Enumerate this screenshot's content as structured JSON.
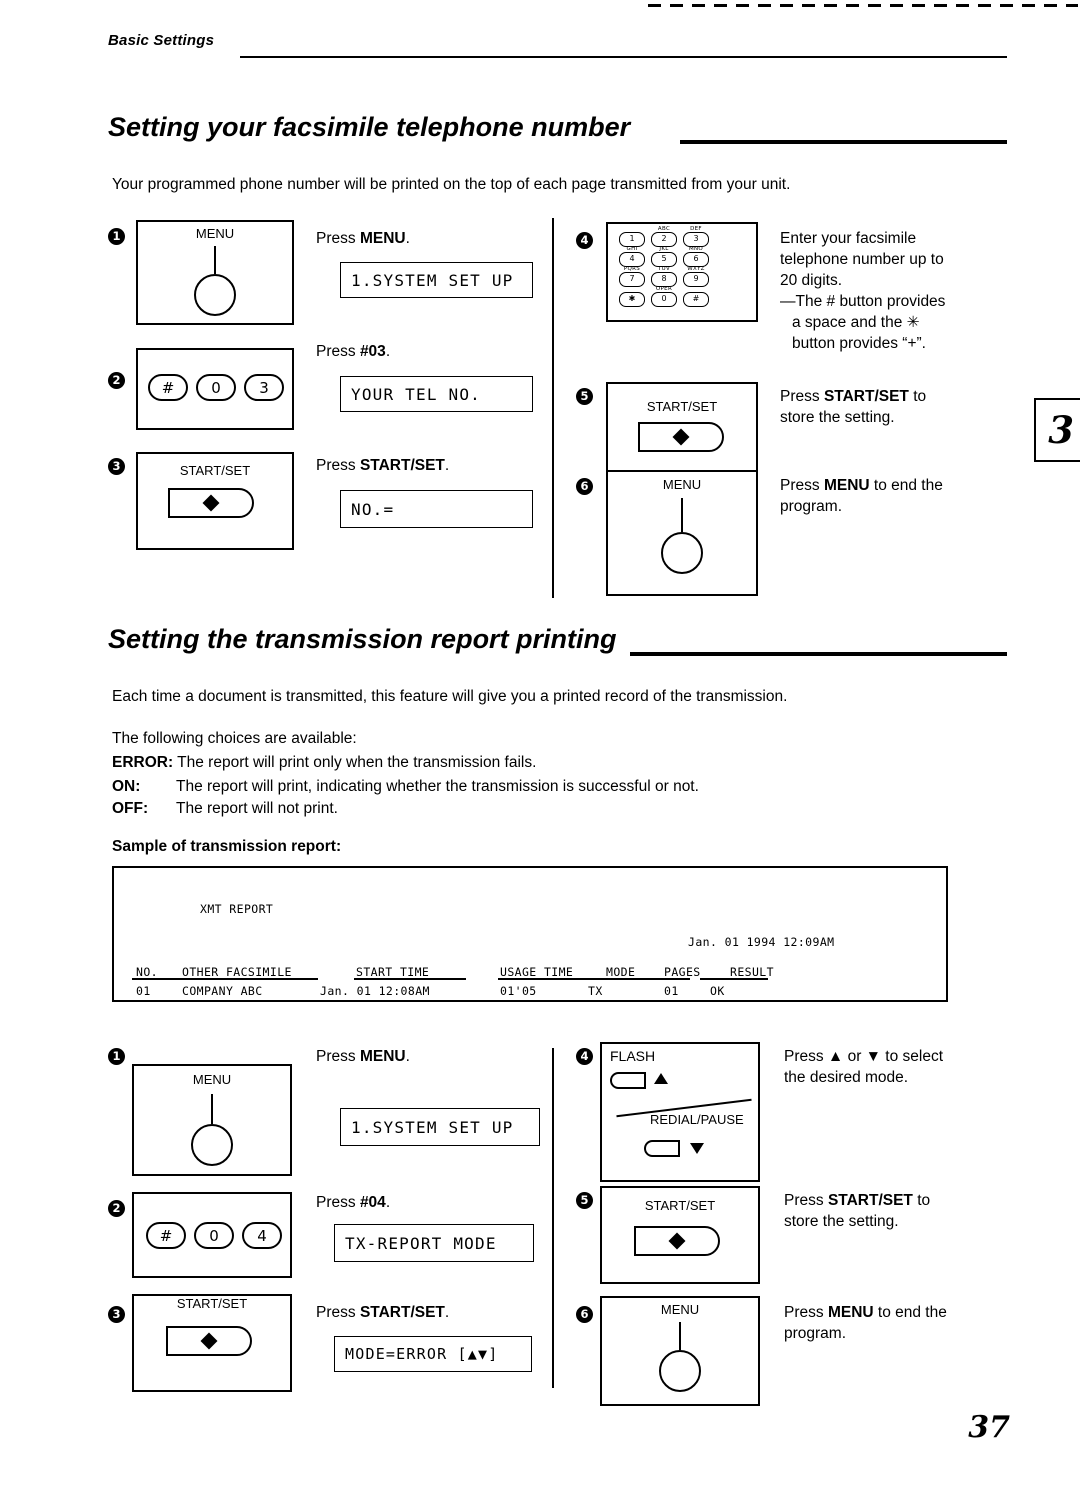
{
  "header": {
    "section_label": "Basic Settings"
  },
  "page_number": "37",
  "chapter_tab": "3",
  "section1": {
    "title": "Setting your facsimile telephone number",
    "intro": "Your programmed phone number will be printed on the top of each page transmitted from your unit.",
    "steps": [
      {
        "num": "1",
        "key_label": "MENU",
        "instruction_plain": "Press ",
        "instruction_bold": "MENU",
        "instruction_tail": ".",
        "lcd": "1.SYSTEM SET UP"
      },
      {
        "num": "2",
        "keys": [
          "#",
          "0",
          "3"
        ],
        "instruction_plain": "Press ",
        "instruction_bold": "#03",
        "instruction_tail": ".",
        "lcd": "YOUR TEL NO."
      },
      {
        "num": "3",
        "key_label": "START/SET",
        "instruction_plain": "Press ",
        "instruction_bold": "START/SET",
        "instruction_tail": ".",
        "lcd": "NO.="
      },
      {
        "num": "4",
        "key_label": "keypad",
        "instruction_lines": [
          "Enter your facsimile",
          "telephone number up to",
          "20 digits.",
          "—The # button provides",
          "a space and the ✳",
          "button provides “+”."
        ]
      },
      {
        "num": "5",
        "key_label": "START/SET",
        "instruction_lines_rich": [
          "Press START/SET to",
          "store the setting."
        ]
      },
      {
        "num": "6",
        "key_label": "MENU",
        "instruction_lines_rich": [
          "Press MENU to end the",
          "program."
        ]
      }
    ]
  },
  "section2": {
    "title": "Setting the transmission report printing",
    "intro": "Each time a document is transmitted, this feature will give you a printed record of the transmission.",
    "choices_lead": "The following choices are available:",
    "choices": [
      {
        "label": "ERROR:",
        "text": "The report will print only when the transmission fails."
      },
      {
        "label": "ON:",
        "text": "The report will print, indicating whether the transmission is successful or not."
      },
      {
        "label": "OFF:",
        "text": "The report will not print."
      }
    ],
    "sample_heading": "Sample of transmission report:",
    "sample_report": {
      "title": "XMT REPORT",
      "datetime": "Jan. 01 1994 12:09AM",
      "columns": [
        "NO.",
        "OTHER FACSIMILE",
        "START TIME",
        "USAGE TIME",
        "MODE",
        "PAGES",
        "RESULT"
      ],
      "row": [
        "01",
        "COMPANY ABC",
        "Jan. 01 12:08AM",
        "01'05",
        "TX",
        "01",
        "OK"
      ]
    },
    "steps": [
      {
        "num": "1",
        "key_label": "MENU",
        "instruction_plain": "Press ",
        "instruction_bold": "MENU",
        "instruction_tail": ".",
        "lcd": "1.SYSTEM SET UP"
      },
      {
        "num": "2",
        "keys": [
          "#",
          "0",
          "4"
        ],
        "instruction_plain": "Press ",
        "instruction_bold": "#04",
        "instruction_tail": ".",
        "lcd": "TX-REPORT MODE"
      },
      {
        "num": "3",
        "key_label": "START/SET",
        "instruction_plain": "Press ",
        "instruction_bold": "START/SET",
        "instruction_tail": ".",
        "lcd": "MODE=ERROR [▲▼]"
      },
      {
        "num": "4",
        "key_top_label": "FLASH",
        "key_bottom_label": "REDIAL/PAUSE",
        "instruction_lines": [
          "Press ▲ or ▼ to select",
          "the desired mode."
        ]
      },
      {
        "num": "5",
        "key_label": "START/SET",
        "instruction_lines_rich": [
          "Press START/SET to",
          "store the setting."
        ]
      },
      {
        "num": "6",
        "key_label": "MENU",
        "instruction_lines_rich": [
          "Press MENU to end the",
          "program."
        ]
      }
    ]
  }
}
